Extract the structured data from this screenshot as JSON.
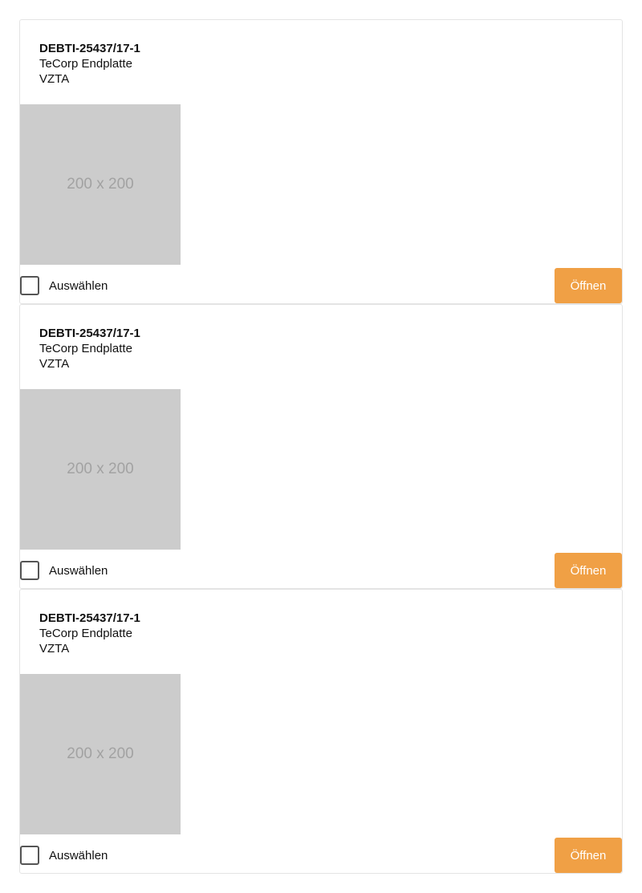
{
  "colors": {
    "accent": "#f0a045",
    "placeholder_bg": "#cccccc",
    "placeholder_text": "#a2a2a2"
  },
  "cards": [
    {
      "id": "DEBTI-25437/17-1",
      "name": "TeCorp Endplatte",
      "type": "VZTA",
      "image_label": "200 x 200",
      "select_label": "Auswählen",
      "selected": false,
      "open_label": "Öffnen"
    },
    {
      "id": "DEBTI-25437/17-1",
      "name": "TeCorp Endplatte",
      "type": "VZTA",
      "image_label": "200 x 200",
      "select_label": "Auswählen",
      "selected": false,
      "open_label": "Öffnen"
    },
    {
      "id": "DEBTI-25437/17-1",
      "name": "TeCorp Endplatte",
      "type": "VZTA",
      "image_label": "200 x 200",
      "select_label": "Auswählen",
      "selected": false,
      "open_label": "Öffnen"
    }
  ]
}
